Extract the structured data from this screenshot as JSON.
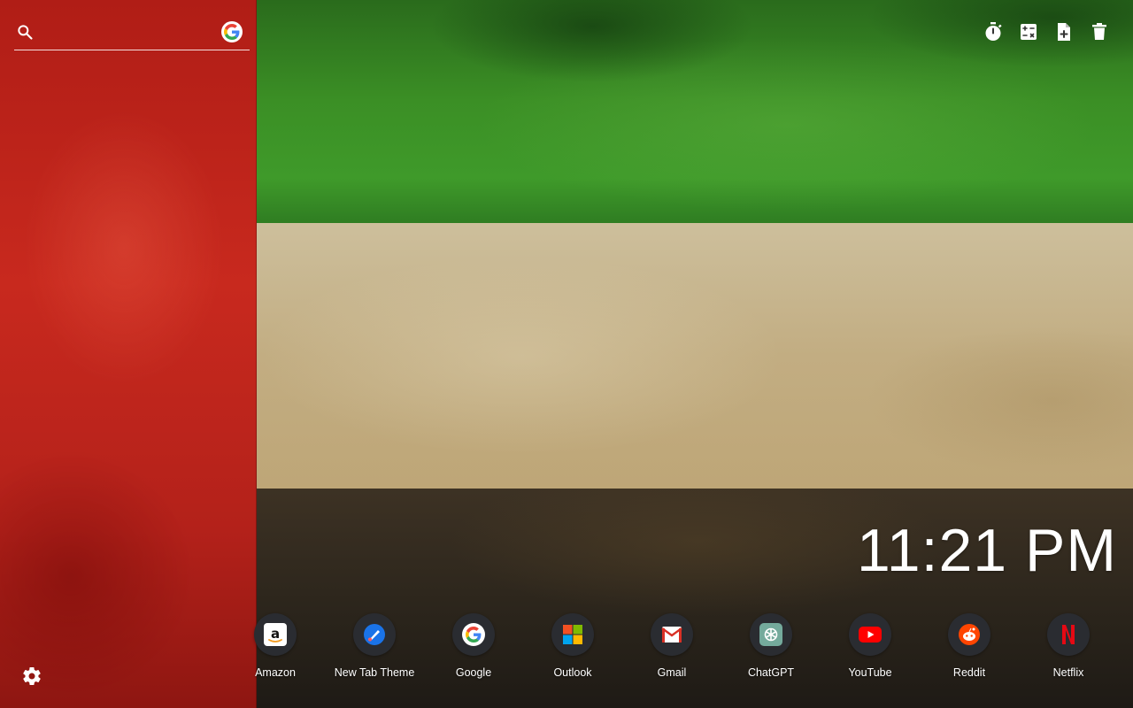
{
  "search": {
    "placeholder": "",
    "engine_icon": "google-g-icon"
  },
  "toolbar": {
    "items": [
      {
        "icon": "timer-icon"
      },
      {
        "icon": "calculator-icon"
      },
      {
        "icon": "add-note-icon"
      },
      {
        "icon": "trash-icon"
      }
    ]
  },
  "clock": {
    "time": "11:21 PM"
  },
  "shortcuts": [
    {
      "label": "Amazon",
      "icon": "amazon-icon"
    },
    {
      "label": "New Tab Theme",
      "icon": "new-tab-theme-icon"
    },
    {
      "label": "Google",
      "icon": "google-icon"
    },
    {
      "label": "Outlook",
      "icon": "microsoft-icon"
    },
    {
      "label": "Gmail",
      "icon": "gmail-icon"
    },
    {
      "label": "ChatGPT",
      "icon": "chatgpt-icon"
    },
    {
      "label": "YouTube",
      "icon": "youtube-icon"
    },
    {
      "label": "Reddit",
      "icon": "reddit-icon"
    },
    {
      "label": "Netflix",
      "icon": "netflix-icon"
    }
  ],
  "settings": {
    "icon": "gear-icon"
  },
  "colors": {
    "flag_red": "#c8291e",
    "flag_green": "#3b8f25",
    "flag_white": "#c2ad82",
    "flag_black": "#2a241b",
    "tile_bg": "#2a2c31"
  }
}
